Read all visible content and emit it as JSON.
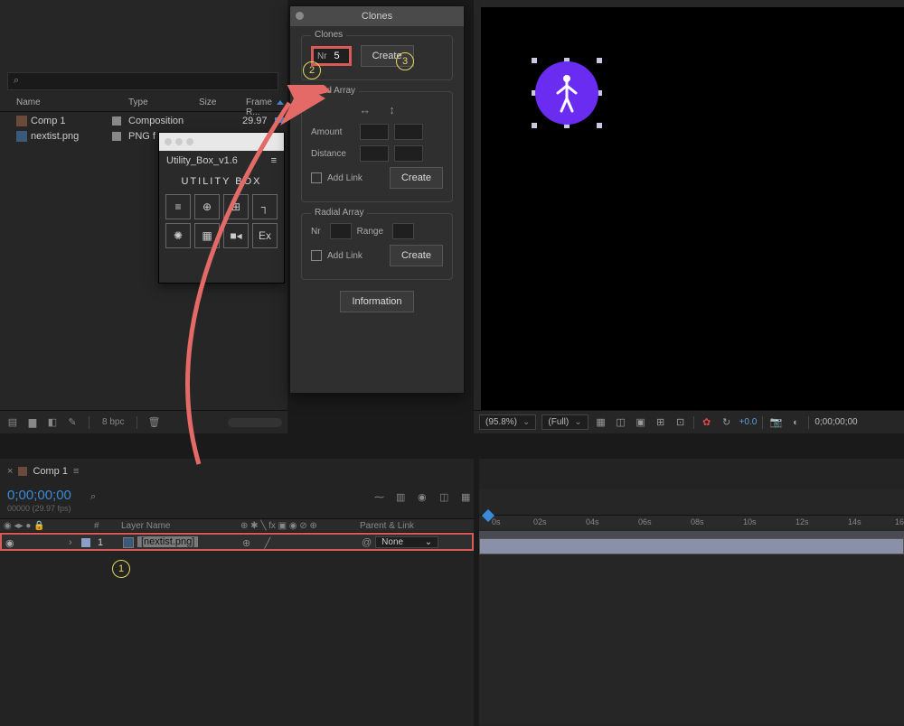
{
  "project": {
    "search_placeholder": "⌕",
    "columns": {
      "name": "Name",
      "type": "Type",
      "size": "Size",
      "frame": "Frame R..."
    },
    "items": [
      {
        "name": "Comp 1",
        "type": "Composition",
        "fps": "29.97",
        "kind": "comp"
      },
      {
        "name": "nextist.png",
        "type": "PNG f",
        "fps": "",
        "kind": "png"
      }
    ],
    "bpc": "8 bpc"
  },
  "utility": {
    "tab": "Utility_Box_v1.6",
    "logo": "UTILITY BOX",
    "btns": [
      "≡",
      "⊕",
      "⊞",
      "┐",
      "✺",
      "▦",
      "■◂",
      "Ex"
    ]
  },
  "clones": {
    "title": "Clones",
    "section_clones": "Clones",
    "nr_label": "Nr",
    "nr_value": "5",
    "create": "Create",
    "grid_title": "Grid Array",
    "amount": "Amount",
    "distance": "Distance",
    "addlink": "Add Link",
    "radial_title": "Radial Array",
    "range": "Range",
    "info": "Information"
  },
  "viewer": {
    "zoom": "(95.8%)",
    "resolution": "(Full)",
    "exposure": "+0.0",
    "timecode": "0;00;00;00"
  },
  "timeline": {
    "tab": "Comp 1",
    "tc": "0;00;00;00",
    "tc_sub": "00000 (29.97 fps)",
    "search": "⌕",
    "cols": {
      "hash": "#",
      "layer": "Layer Name",
      "parent": "Parent & Link"
    },
    "row": {
      "num": "1",
      "name": "[nextist.png]",
      "parent": "None"
    },
    "ticks": [
      "0s",
      "02s",
      "04s",
      "06s",
      "08s",
      "10s",
      "12s",
      "14s",
      "16"
    ]
  },
  "annotations": {
    "1": "1",
    "2": "2",
    "3": "3"
  }
}
